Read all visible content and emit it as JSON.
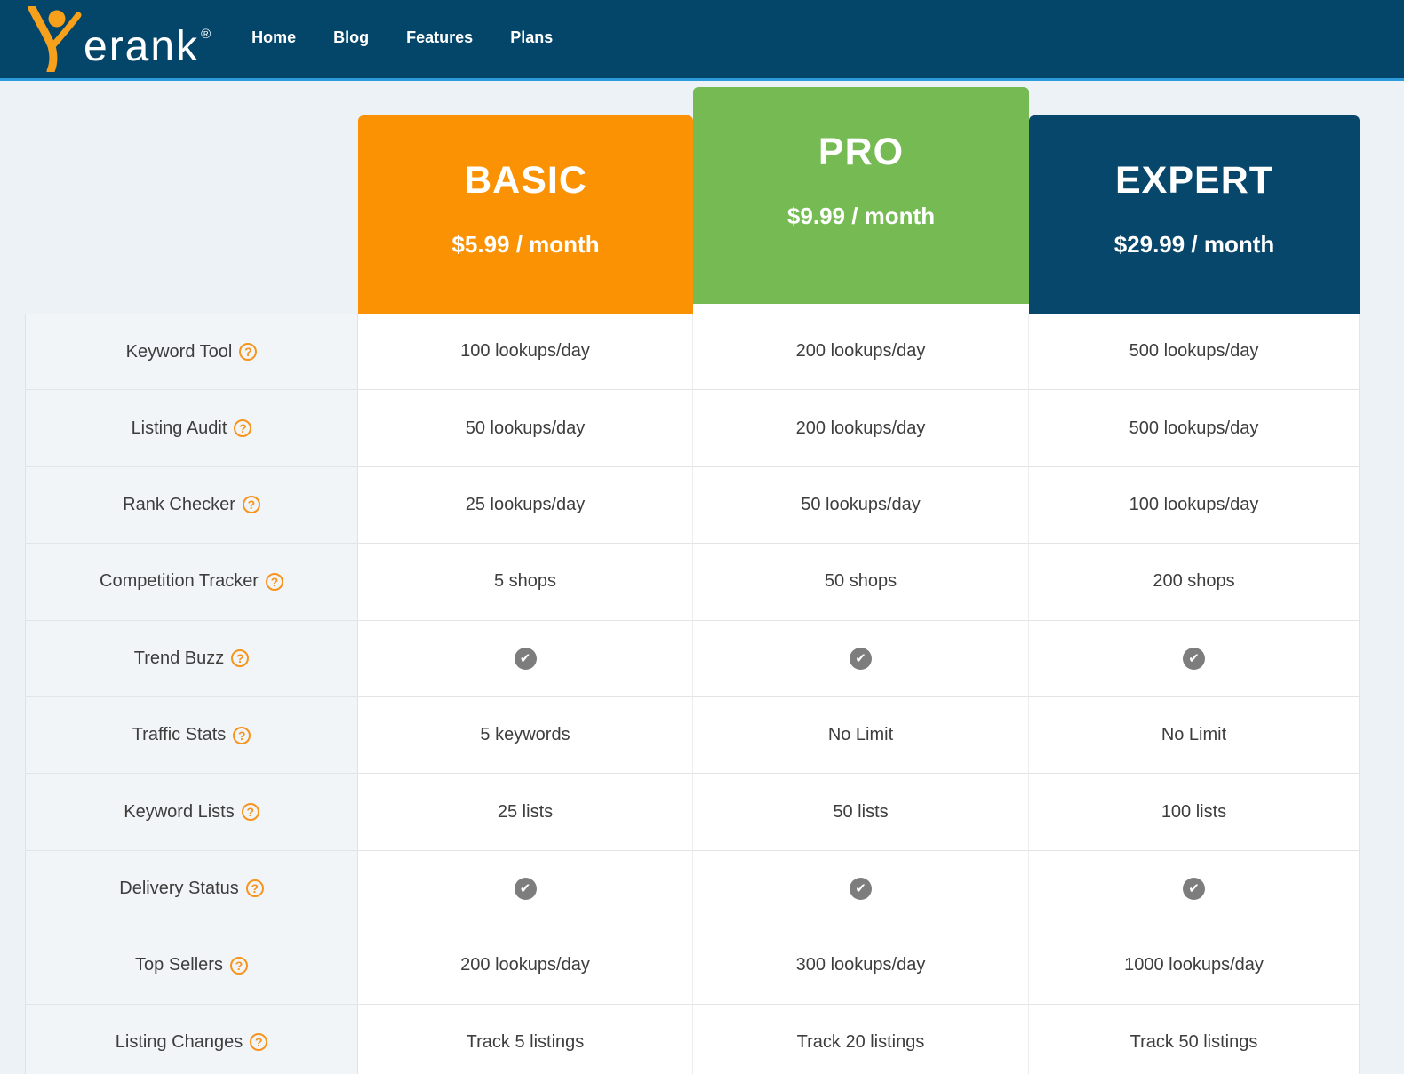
{
  "brand": {
    "logo_text": "erank",
    "registered_mark": "®",
    "logo_accent_color": "#f7a01b",
    "navbar_color": "#04456a",
    "accent_line_color": "#2b9bdc"
  },
  "nav": {
    "items": [
      {
        "label": "Home"
      },
      {
        "label": "Blog"
      },
      {
        "label": "Features"
      },
      {
        "label": "Plans"
      }
    ]
  },
  "plans": [
    {
      "name": "BASIC",
      "price_line": "$5.99 / month",
      "color": "#fb9204"
    },
    {
      "name": "PRO",
      "price_line": "$9.99 / month",
      "color": "#75ba53",
      "highlighted": true
    },
    {
      "name": "EXPERT",
      "price_line": "$29.99 / month",
      "color": "#07476c"
    }
  ],
  "table": {
    "help_glyph": "?",
    "check_glyph": "✔",
    "check_sentinel": "check",
    "check_color": "#7d7d7d",
    "help_color": "#f7941e",
    "rows": [
      {
        "feature": "Keyword Tool",
        "values": [
          "100 lookups/day",
          "200 lookups/day",
          "500 lookups/day"
        ]
      },
      {
        "feature": "Listing Audit",
        "values": [
          "50 lookups/day",
          "200 lookups/day",
          "500 lookups/day"
        ]
      },
      {
        "feature": "Rank Checker",
        "values": [
          "25 lookups/day",
          "50 lookups/day",
          "100 lookups/day"
        ]
      },
      {
        "feature": "Competition Tracker",
        "values": [
          "5 shops",
          "50 shops",
          "200 shops"
        ]
      },
      {
        "feature": "Trend Buzz",
        "values": [
          "check",
          "check",
          "check"
        ]
      },
      {
        "feature": "Traffic Stats",
        "values": [
          "5 keywords",
          "No Limit",
          "No Limit"
        ]
      },
      {
        "feature": "Keyword Lists",
        "values": [
          "25 lists",
          "50 lists",
          "100 lists"
        ]
      },
      {
        "feature": "Delivery Status",
        "values": [
          "check",
          "check",
          "check"
        ]
      },
      {
        "feature": "Top Sellers",
        "values": [
          "200 lookups/day",
          "300 lookups/day",
          "1000 lookups/day"
        ]
      },
      {
        "feature": "Listing Changes",
        "values": [
          "Track 5 listings",
          "Track 20 listings",
          "Track 50 listings"
        ]
      }
    ]
  }
}
